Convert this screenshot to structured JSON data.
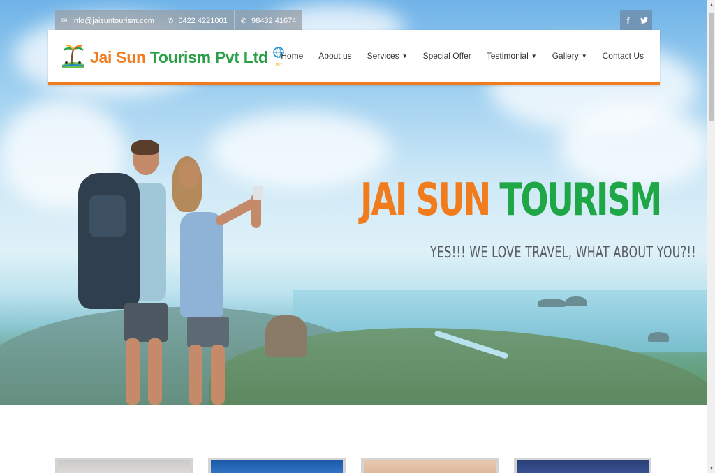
{
  "topbar": {
    "email": "info@jaisuntourism.com",
    "phone1": "0422 4221001",
    "phone2": "98432 41674",
    "email_icon": "envelope-icon",
    "phone_icon": "phone-icon"
  },
  "social": {
    "facebook": "f",
    "twitter": "t"
  },
  "header": {
    "logo_part1": "Jai Sun ",
    "logo_part2": "Tourism Pvt Ltd",
    "logo_badge": "JST"
  },
  "nav": {
    "items": [
      {
        "label": "Home",
        "dropdown": false
      },
      {
        "label": "About us",
        "dropdown": false
      },
      {
        "label": "Services",
        "dropdown": true
      },
      {
        "label": "Special Offer",
        "dropdown": false
      },
      {
        "label": "Testimonial",
        "dropdown": true
      },
      {
        "label": "Gallery",
        "dropdown": true
      },
      {
        "label": "Contact Us",
        "dropdown": false
      }
    ]
  },
  "hero": {
    "headline_orange": "JAI SUN ",
    "headline_green": "TOURISM",
    "tagline": "YES!!! WE LOVE TRAVEL, WHAT ABOUT YOU?!!"
  },
  "colors": {
    "brand_orange": "#f07c1e",
    "brand_green": "#2aa046"
  }
}
